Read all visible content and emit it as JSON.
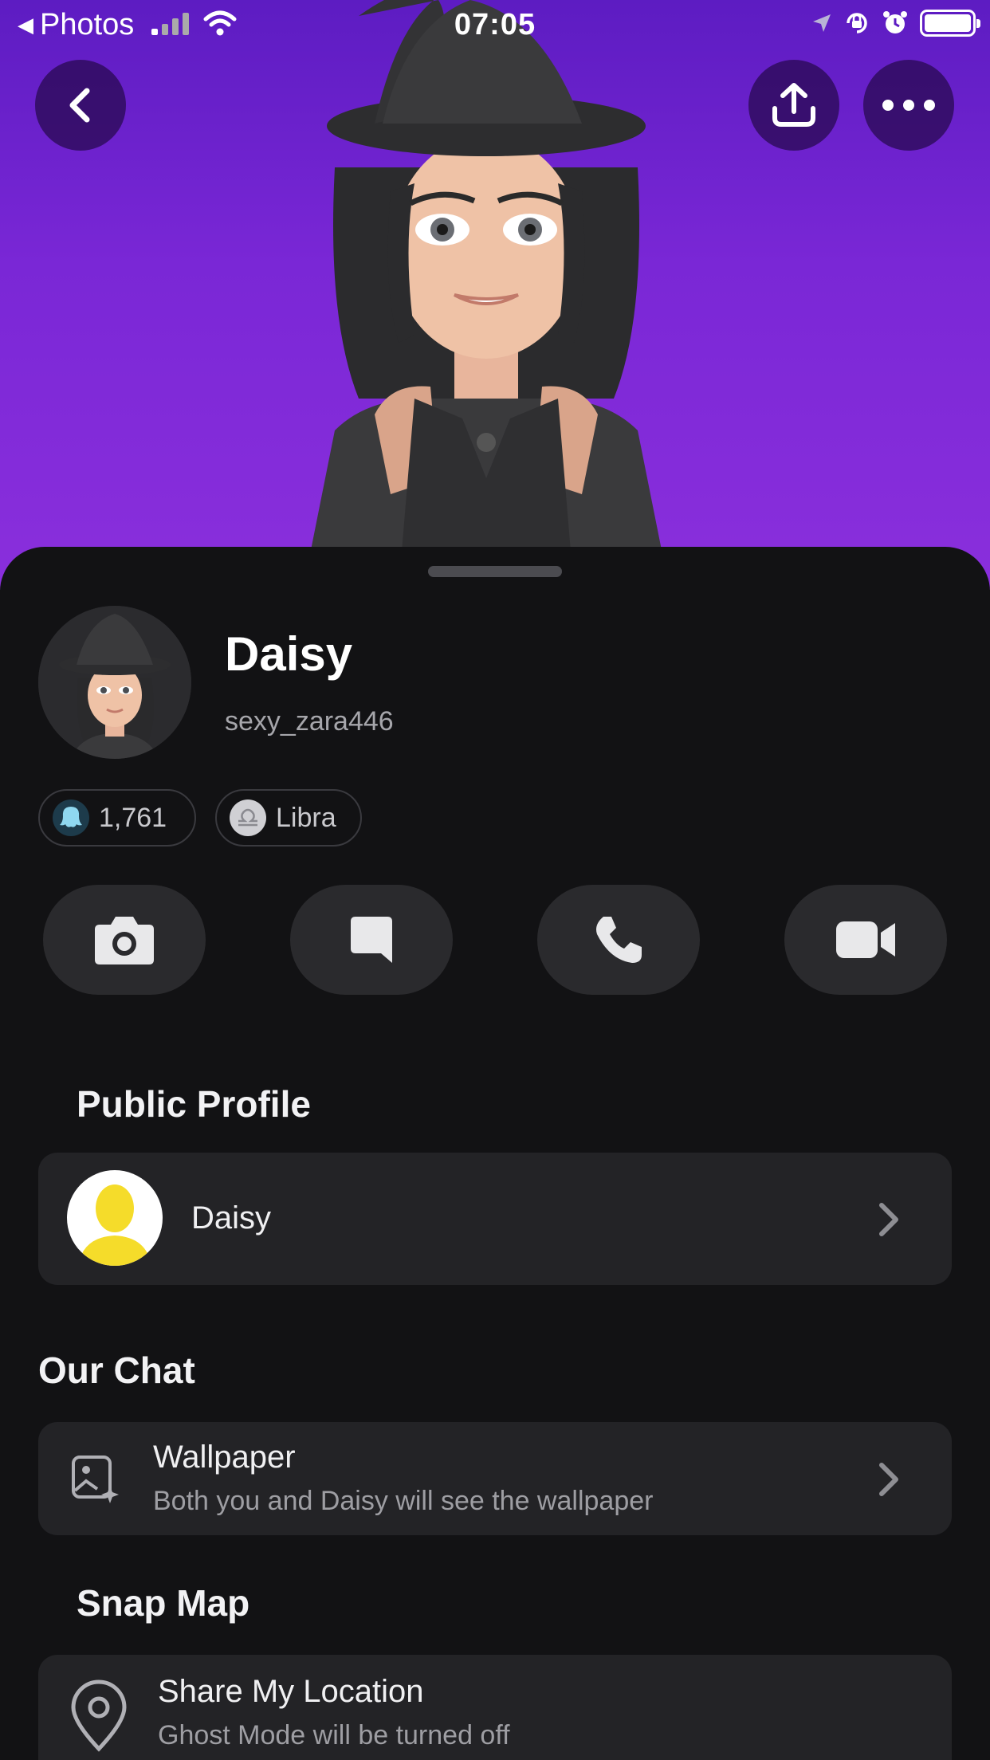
{
  "status_bar": {
    "back_app": "Photos",
    "time": "07:05"
  },
  "profile": {
    "name": "Daisy",
    "username": "sexy_zara446",
    "snapscore": "1,761",
    "zodiac": "Libra"
  },
  "actions": [
    "camera",
    "chat",
    "call",
    "video-call"
  ],
  "public_profile": {
    "section_title": "Public Profile",
    "name": "Daisy"
  },
  "our_chat": {
    "section_title": "Our Chat",
    "wallpaper_title": "Wallpaper",
    "wallpaper_subtitle": "Both you and Daisy will see the wallpaper"
  },
  "snap_map": {
    "section_title": "Snap Map",
    "share_title": "Share My Location",
    "share_subtitle": "Ghost Mode will be turned off"
  },
  "colors": {
    "hero_purple": "#7a27d6",
    "background": "#121214",
    "card": "#232326",
    "snap_yellow": "#fffc00"
  }
}
